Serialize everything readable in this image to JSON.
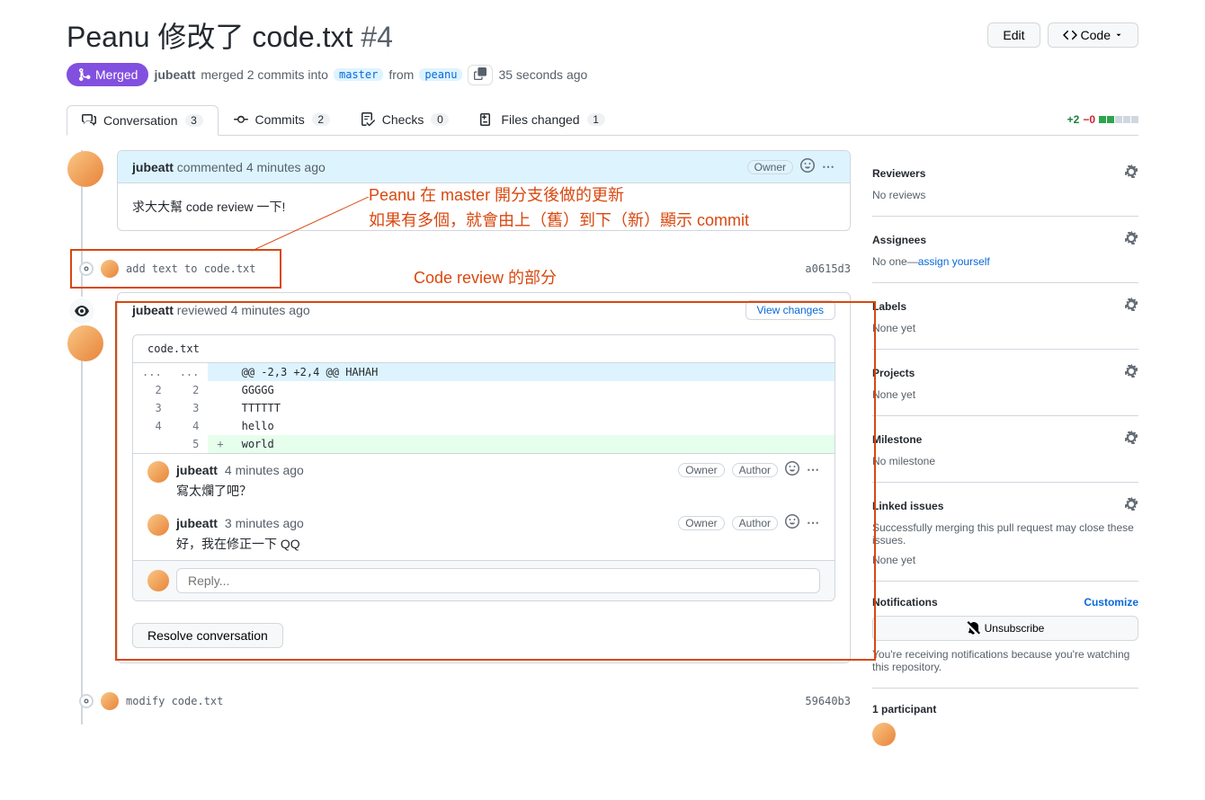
{
  "header": {
    "title": "Peanu 修改了 code.txt",
    "number": "#4",
    "edit_button": "Edit",
    "code_button": "Code"
  },
  "state": {
    "label": "Merged"
  },
  "meta": {
    "author": "jubeatt",
    "merged_text": "merged 2 commits into",
    "base_branch": "master",
    "from_text": "from",
    "head_branch": "peanu",
    "time_ago": "35 seconds ago"
  },
  "tabs": {
    "conversation": "Conversation",
    "conversation_count": "3",
    "commits": "Commits",
    "commits_count": "2",
    "checks": "Checks",
    "checks_count": "0",
    "files": "Files changed",
    "files_count": "1"
  },
  "diff_stats": {
    "additions": "+2",
    "deletions": "−0"
  },
  "first_comment": {
    "author": "jubeatt",
    "action": "commented",
    "time": "4 minutes ago",
    "owner_badge": "Owner",
    "body": "求大大幫 code review 一下!"
  },
  "commit1": {
    "message": "add text to code.txt",
    "sha": "a0615d3"
  },
  "review": {
    "author": "jubeatt",
    "action": "reviewed",
    "time": "4 minutes ago",
    "view_changes": "View changes",
    "file": "code.txt",
    "hunk_header": "@@ -2,3 +2,4 @@ HAHAH",
    "ellipsis": "...",
    "lines": [
      {
        "old": "2",
        "new": "2",
        "marker": " ",
        "text": "GGGGG"
      },
      {
        "old": "3",
        "new": "3",
        "marker": " ",
        "text": "TTTTTT"
      },
      {
        "old": "4",
        "new": "4",
        "marker": " ",
        "text": "hello"
      },
      {
        "old": "",
        "new": "5",
        "marker": "+",
        "text": "world"
      }
    ],
    "comments": [
      {
        "author": "jubeatt",
        "time": "4 minutes ago",
        "owner": "Owner",
        "author_badge": "Author",
        "body": "寫太爛了吧？"
      },
      {
        "author": "jubeatt",
        "time": "3 minutes ago",
        "owner": "Owner",
        "author_badge": "Author",
        "body": "好，我在修正一下 QQ"
      }
    ],
    "reply_placeholder": "Reply...",
    "resolve": "Resolve conversation"
  },
  "commit2": {
    "message": "modify code.txt",
    "sha": "59640b3"
  },
  "sidebar": {
    "reviewers": {
      "title": "Reviewers",
      "text": "No reviews"
    },
    "assignees": {
      "title": "Assignees",
      "text_pre": "No one—",
      "link": "assign yourself"
    },
    "labels": {
      "title": "Labels",
      "text": "None yet"
    },
    "projects": {
      "title": "Projects",
      "text": "None yet"
    },
    "milestone": {
      "title": "Milestone",
      "text": "No milestone"
    },
    "linked": {
      "title": "Linked issues",
      "text": "Successfully merging this pull request may close these issues.",
      "none": "None yet"
    },
    "notifications": {
      "title": "Notifications",
      "customize": "Customize",
      "unsubscribe": "Unsubscribe",
      "note": "You're receiving notifications because you're watching this repository."
    },
    "participants": {
      "title": "1 participant"
    }
  },
  "annotations": {
    "line1": "Peanu 在 master 開分支後做的更新",
    "line2": "如果有多個，就會由上（舊）到下（新）顯示 commit",
    "line3": "Code review 的部分"
  }
}
